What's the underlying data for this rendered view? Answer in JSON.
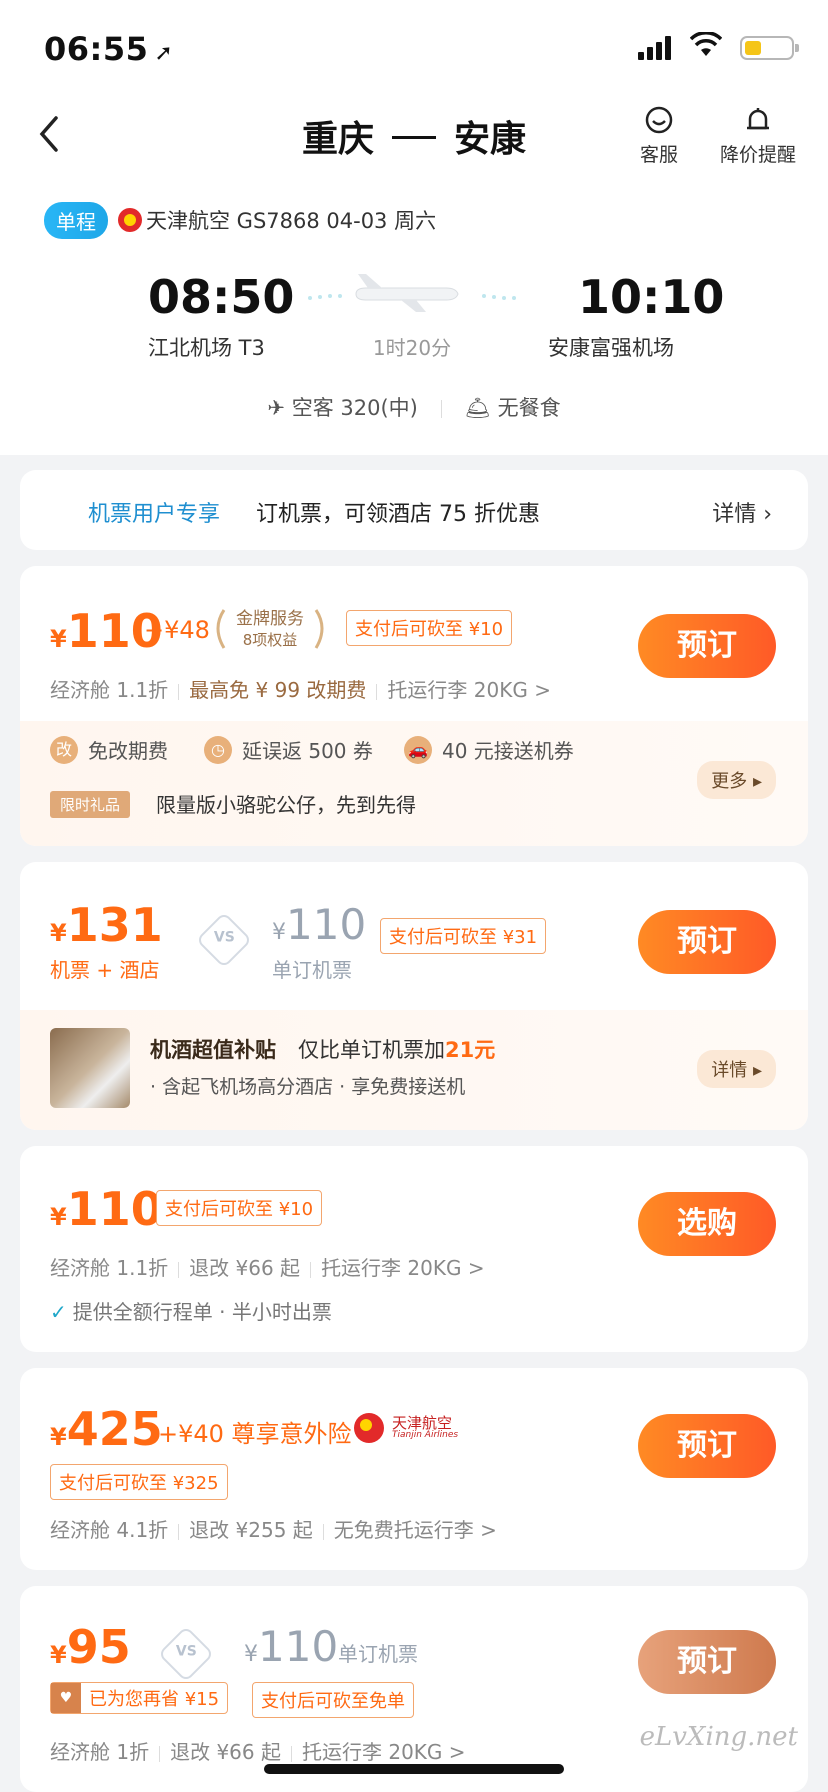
{
  "status": {
    "time": "06:55",
    "location_icon": "location-arrow-icon"
  },
  "nav": {
    "from": "重庆",
    "to": "安康",
    "service_label": "客服",
    "price_alert_label": "降价提醒"
  },
  "flight": {
    "trip_type": "单程",
    "info": "天津航空 GS7868  04-03 周六",
    "dep_time": "08:50",
    "dep_airport": "江北机场 T3",
    "arr_time": "10:10",
    "arr_airport": "安康富强机场",
    "duration": "1时20分",
    "aircraft": "空客 320(中)",
    "meal": "无餐食"
  },
  "promo": {
    "tag": "机票用户专享",
    "text": "订机票，可领酒店 75 折优惠",
    "link": "详情 ›"
  },
  "cards": [
    {
      "currency": "¥",
      "price": "110",
      "addon": "+¥48",
      "gold_title": "金牌服务",
      "gold_sub": "8项权益",
      "discount": "支付后可砍至 ¥10",
      "button": "预订",
      "details": [
        "经济舱 1.1折",
        "最高免 ¥ 99 改期费",
        "托运行李 20KG >"
      ],
      "benefits": [
        {
          "icon": "改",
          "text": "免改期费"
        },
        {
          "icon": "◷",
          "text": "延误返 500 券"
        },
        {
          "icon": "🚗",
          "text": "40 元接送机券"
        }
      ],
      "gift_tag": "限时礼品",
      "gift_text": "限量版小骆驼公仔，先到先得",
      "more": "更多 ▸"
    },
    {
      "currency": "¥",
      "price": "131",
      "price_label": "机票 + 酒店",
      "vs": "VS",
      "compare_price": "110",
      "compare_label": "单订机票",
      "discount": "支付后可砍至 ¥31",
      "button": "预订",
      "subsidy_title": "机酒超值补贴",
      "subsidy_prefix": "仅比单订机票加",
      "subsidy_amount": "21元",
      "subsidy_line": "· 含起飞机场高分酒店 · 享免费接送机",
      "detail_pill": "详情 ▸"
    },
    {
      "currency": "¥",
      "price": "110",
      "discount": "支付后可砍至 ¥10",
      "button": "选购",
      "details": [
        "经济舱 1.1折",
        "退改 ¥66 起",
        "托运行李 20KG >"
      ],
      "note": "提供全额行程单 · 半小时出票"
    },
    {
      "currency": "¥",
      "price": "425",
      "addon": "+¥40 尊享意外险",
      "airline_logo_text": "天津航空",
      "airline_logo_en": "Tianjin Airlines",
      "discount": "支付后可砍至 ¥325",
      "button": "预订",
      "details": [
        "经济舱 4.1折",
        "退改 ¥255 起",
        "无免费托运行李 >"
      ]
    },
    {
      "currency": "¥",
      "price": "95",
      "vs": "VS",
      "compare_price": "110",
      "compare_label": "单订机票",
      "saved": "已为您再省 ¥15",
      "discount": "支付后可砍至免单",
      "button": "预订",
      "details": [
        "经济舱 1折",
        "退改 ¥66 起",
        "托运行李 20KG >"
      ]
    }
  ],
  "watermark": "eLvXing.net",
  "colors": {
    "accent": "#ff6a13",
    "blue": "#1f8fd0",
    "gold": "#d9a06f"
  }
}
